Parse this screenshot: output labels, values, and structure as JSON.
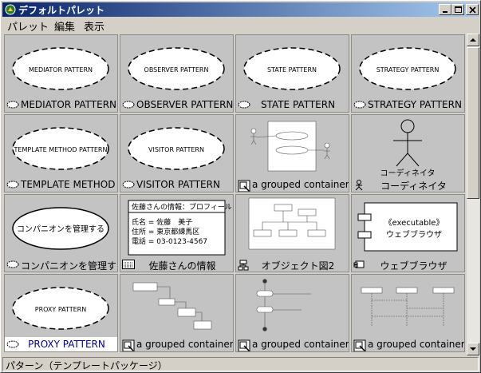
{
  "window": {
    "title": "デフォルトパレット"
  },
  "menu": [
    "パレット",
    "編集",
    "表示"
  ],
  "cells": [
    {
      "type": "ellipse",
      "ellipse_text": "MEDIATOR PATTERN",
      "label": "MEDIATOR PATTERN",
      "icon": "ellipse-icon"
    },
    {
      "type": "ellipse",
      "ellipse_text": "OBSERVER PATTERN",
      "label": "OBSERVER PATTERN",
      "icon": "ellipse-icon"
    },
    {
      "type": "ellipse",
      "ellipse_text": "STATE PATTERN",
      "label": "STATE PATTERN",
      "icon": "ellipse-icon"
    },
    {
      "type": "ellipse",
      "ellipse_text": "STRATEGY PATTERN",
      "label": "STRATEGY PATTERN",
      "icon": "ellipse-icon"
    },
    {
      "type": "ellipse",
      "ellipse_text": "TEMPLATE METHOD PATTERN",
      "label": "TEMPLATE METHOD PATTERN",
      "icon": "ellipse-icon"
    },
    {
      "type": "ellipse",
      "ellipse_text": "VISITOR PATTERN",
      "label": "VISITOR PATTERN",
      "icon": "ellipse-icon"
    },
    {
      "type": "usecase-diagram",
      "label": "a grouped container",
      "icon": "grouped-container-icon"
    },
    {
      "type": "actor",
      "actor_text": "コーディネイタ",
      "label": "コーディネイタ",
      "icon": "actor-icon"
    },
    {
      "type": "ellipse-solid",
      "ellipse_text": "コンパニオンを管理する",
      "label": "コンパニオンを管理する",
      "icon": "ellipse-icon"
    },
    {
      "type": "object",
      "object_title": "佐藤さんの情報：プロフィール",
      "object_lines": [
        "氏名 = 佐藤　美子",
        "住所 = 東京都練馬区",
        "電話 = 03-0123-4567"
      ],
      "label": "佐藤さんの情報",
      "icon": "object-icon"
    },
    {
      "type": "object-diagram",
      "label": "オブジェクト図2",
      "icon": "object-diagram-icon"
    },
    {
      "type": "component",
      "component_lines": [
        "《executable》",
        "ウェブブラウザ"
      ],
      "label": "ウェブブラウザ",
      "icon": "component-icon"
    },
    {
      "type": "ellipse",
      "ellipse_text": "PROXY PATTERN",
      "label": "PROXY PATTERN",
      "icon": "ellipse-icon",
      "selected": true
    },
    {
      "type": "collab-diagram",
      "label": "a grouped container",
      "icon": "grouped-container-icon"
    },
    {
      "type": "activity-diagram",
      "label": "a grouped container",
      "icon": "grouped-container-icon"
    },
    {
      "type": "sequence-diagram",
      "label": "a grouped container",
      "icon": "grouped-container-icon"
    }
  ],
  "status": "パターン（テンプレートパッケージ）"
}
